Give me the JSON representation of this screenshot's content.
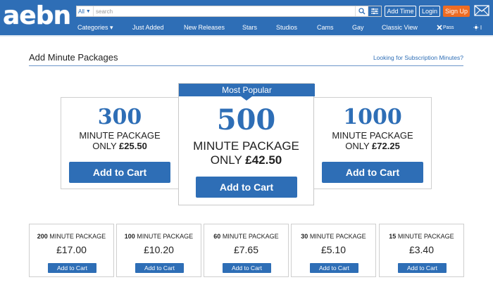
{
  "header": {
    "logo_text": "aebn",
    "search": {
      "scope": "All",
      "placeholder": "search"
    },
    "buttons": {
      "add_time": "Add Time",
      "login": "Login",
      "signup": "Sign Up"
    },
    "nav": [
      {
        "label": "Categories ▾"
      },
      {
        "label": "Just Added"
      },
      {
        "label": "New Releases"
      },
      {
        "label": "Stars"
      },
      {
        "label": "Studios"
      },
      {
        "label": "Cams"
      },
      {
        "label": "Gay"
      },
      {
        "label": "Classic View"
      },
      {
        "label": "Pass"
      }
    ]
  },
  "page": {
    "title": "Add Minute Packages",
    "subscription_link": "Looking for Subscription Minutes?"
  },
  "featured": {
    "left": {
      "minutes": "300",
      "label": "MINUTE PACKAGE",
      "only": "ONLY",
      "price": "£25.50",
      "button": "Add to Cart"
    },
    "center": {
      "banner": "Most Popular",
      "minutes": "500",
      "label": "MINUTE PACKAGE",
      "only": "ONLY",
      "price": "£42.50",
      "button": "Add to Cart"
    },
    "right": {
      "minutes": "1000",
      "label": "MINUTE PACKAGE",
      "only": "ONLY",
      "price": "£72.25",
      "button": "Add to Cart"
    }
  },
  "packages": [
    {
      "minutes": "200",
      "label": "MINUTE PACKAGE",
      "price": "£17.00",
      "button": "Add to Cart"
    },
    {
      "minutes": "100",
      "label": "MINUTE PACKAGE",
      "price": "£10.20",
      "button": "Add to Cart"
    },
    {
      "minutes": "60",
      "label": "MINUTE PACKAGE",
      "price": "£7.65",
      "button": "Add to Cart"
    },
    {
      "minutes": "30",
      "label": "MINUTE PACKAGE",
      "price": "£5.10",
      "button": "Add to Cart"
    },
    {
      "minutes": "15",
      "label": "MINUTE PACKAGE",
      "price": "£3.40",
      "button": "Add to Cart"
    }
  ],
  "colors": {
    "brand_blue": "#2e6eb6",
    "signup_orange": "#ef6c22"
  }
}
